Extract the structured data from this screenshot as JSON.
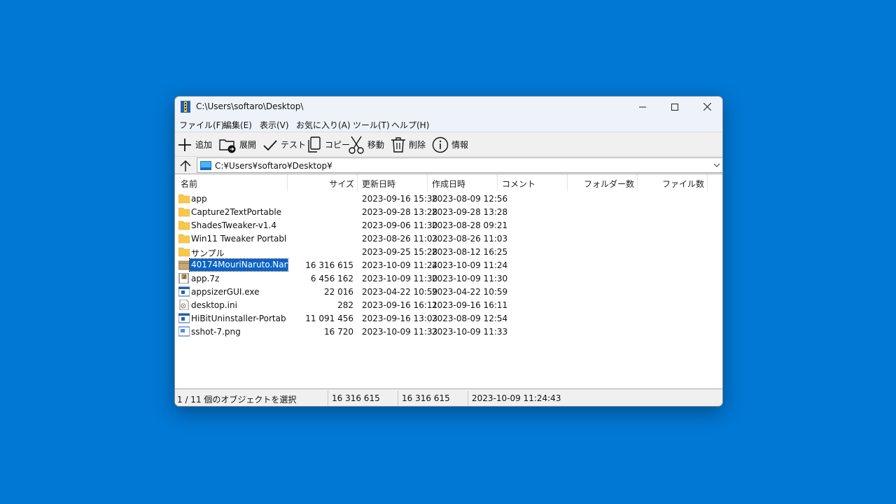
{
  "window": {
    "title": "C:\\Users\\softaro\\Desktop\\"
  },
  "menu": [
    "ファイル(F)",
    "編集(E)",
    "表示(V)",
    "お気に入り(A)",
    "ツール(T)",
    "ヘルプ(H)"
  ],
  "toolbar": {
    "add": "追加",
    "extract": "展開",
    "test": "テスト",
    "copy": "コピー",
    "move": "移動",
    "delete": "削除",
    "info": "情報"
  },
  "address": {
    "path": "C:¥Users¥softaro¥Desktop¥"
  },
  "columns": {
    "name": "名前",
    "size": "サイズ",
    "modified": "更新日時",
    "created": "作成日時",
    "comment": "コメント",
    "folders": "フォルダー数",
    "files": "ファイル数"
  },
  "files": [
    {
      "name": "app",
      "type": "folder",
      "size": "",
      "modified": "2023-09-16 15:38",
      "created": "2023-08-09 12:56"
    },
    {
      "name": "Capture2TextPortable",
      "type": "folder",
      "size": "",
      "modified": "2023-09-28 13:28",
      "created": "2023-09-28 13:28"
    },
    {
      "name": "ShadesTweaker-v1.4",
      "type": "folder",
      "size": "",
      "modified": "2023-09-06 11:30",
      "created": "2023-08-28 09:21"
    },
    {
      "name": "Win11 Tweaker Portable...",
      "type": "folder",
      "size": "",
      "modified": "2023-08-26 11:03",
      "created": "2023-08-26 11:03"
    },
    {
      "name": "サンプル",
      "type": "folder",
      "size": "",
      "modified": "2023-09-25 15:28",
      "created": "2023-08-12 16:25"
    },
    {
      "name": "40174MouriNaruto.Nan...",
      "type": "package",
      "size": "16 316 615",
      "modified": "2023-10-09 11:24",
      "created": "2023-10-09 11:24",
      "selected": true
    },
    {
      "name": "app.7z",
      "type": "archive",
      "size": "6 456 162",
      "modified": "2023-10-09 11:30",
      "created": "2023-10-09 11:30"
    },
    {
      "name": "appsizerGUI.exe",
      "type": "exe",
      "size": "22 016",
      "modified": "2023-04-22 10:59",
      "created": "2023-04-22 10:59"
    },
    {
      "name": "desktop.ini",
      "type": "ini",
      "size": "282",
      "modified": "2023-09-16 16:11",
      "created": "2023-09-16 16:11"
    },
    {
      "name": "HiBitUninstaller-Portabl...",
      "type": "exe",
      "size": "11 091 456",
      "modified": "2023-09-16 13:03",
      "created": "2023-08-09 12:54"
    },
    {
      "name": "sshot-7.png",
      "type": "image",
      "size": "16 720",
      "modified": "2023-10-09 11:33",
      "created": "2023-10-09 11:33"
    }
  ],
  "status": {
    "selection": "1 / 11 個のオブジェクトを選択",
    "size1": "16 316 615",
    "size2": "16 316 615",
    "datetime": "2023-10-09 11:24:43"
  },
  "colors": {
    "desktop": "#0078d4",
    "selection": "#0a64c8",
    "folder": "#f8c84a"
  }
}
